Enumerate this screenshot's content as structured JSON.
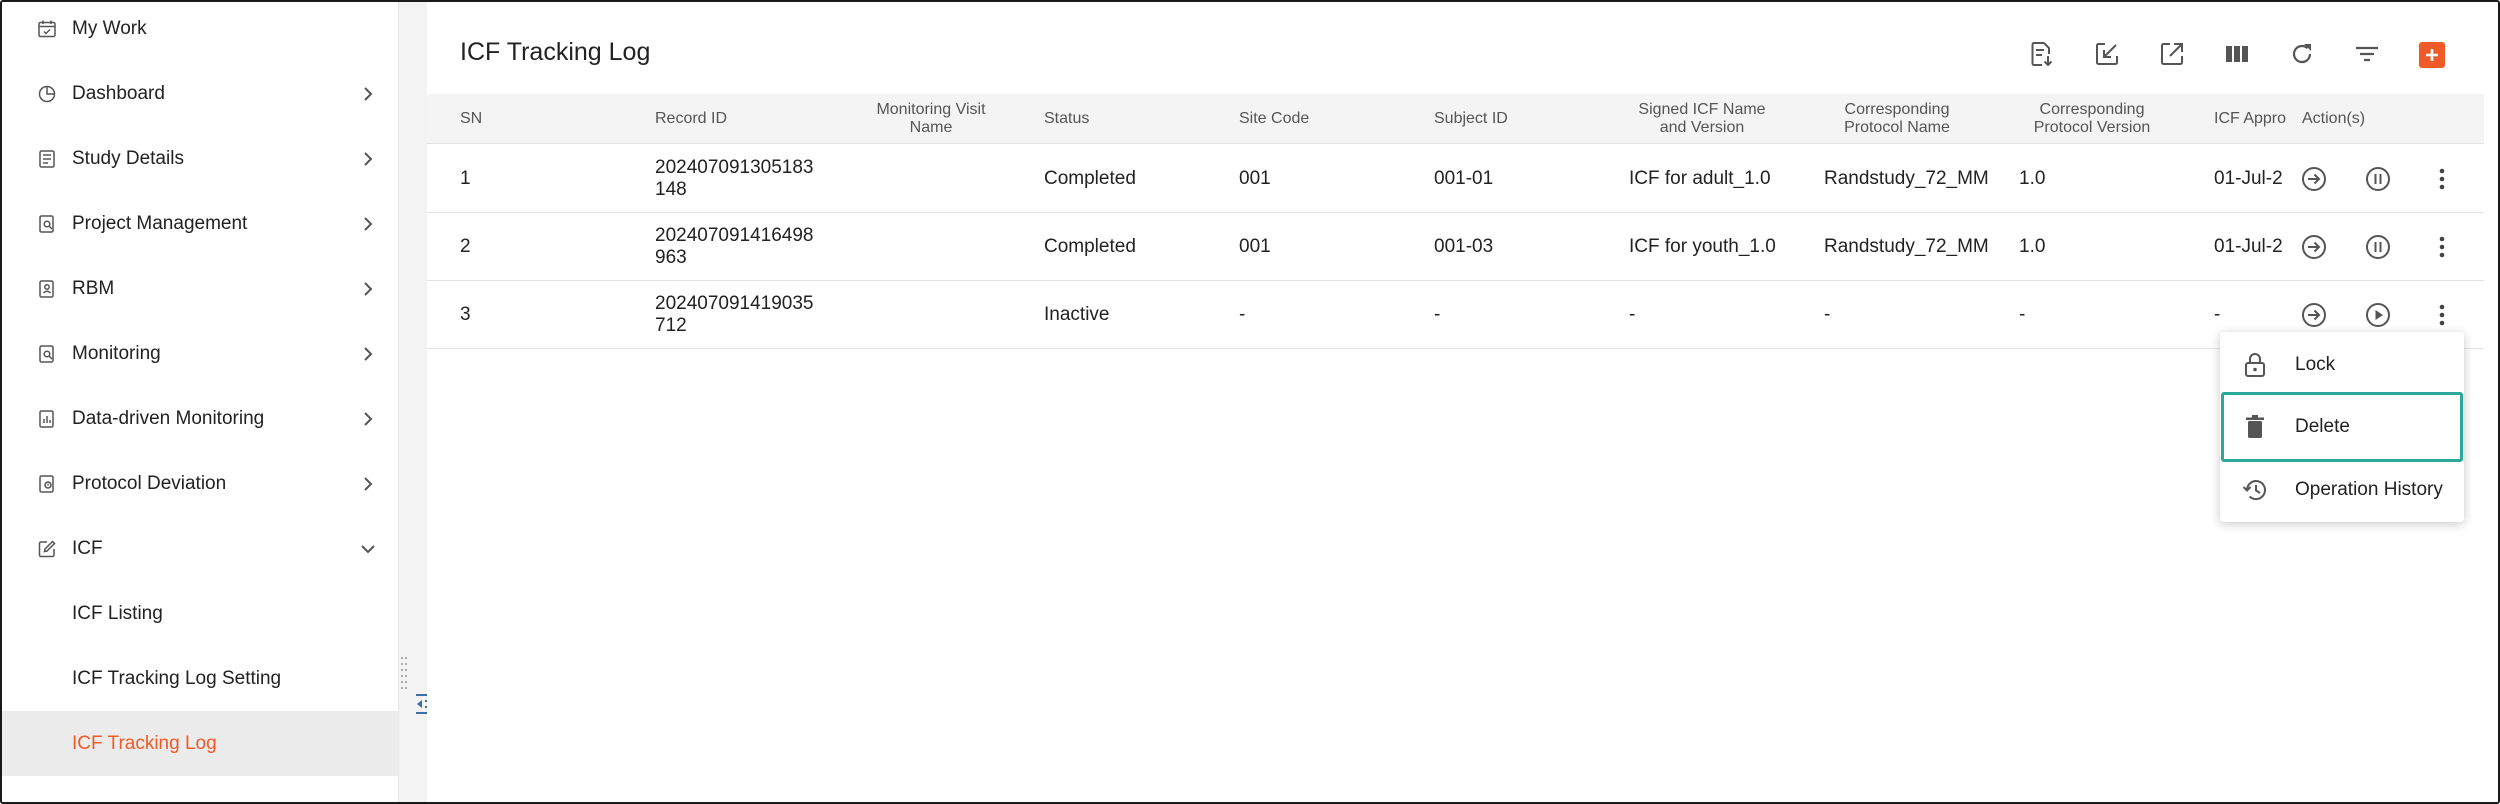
{
  "sidebar": {
    "items": [
      {
        "label": "My Work"
      },
      {
        "label": "Dashboard"
      },
      {
        "label": "Study Details"
      },
      {
        "label": "Project Management"
      },
      {
        "label": "RBM"
      },
      {
        "label": "Monitoring"
      },
      {
        "label": "Data-driven Monitoring"
      },
      {
        "label": "Protocol Deviation"
      },
      {
        "label": "ICF"
      }
    ],
    "sub_items": [
      {
        "label": "ICF Listing"
      },
      {
        "label": "ICF Tracking Log Setting"
      },
      {
        "label": "ICF Tracking Log"
      }
    ]
  },
  "page": {
    "title": "ICF Tracking Log"
  },
  "toolbar": {
    "icons": [
      "export-icon",
      "import-icon",
      "open-external-icon",
      "columns-icon",
      "refresh-icon",
      "filter-icon",
      "add-icon"
    ]
  },
  "table": {
    "headers": {
      "sn": "SN",
      "record_id": "Record ID",
      "monitoring_visit_name": "Monitoring Visit\nName",
      "status": "Status",
      "site_code": "Site Code",
      "subject_id": "Subject ID",
      "signed_icf": "Signed ICF Name\nand Version",
      "protocol_name": "Corresponding\nProtocol Name",
      "protocol_version": "Corresponding\nProtocol Version",
      "icf_approval": "ICF Appro",
      "actions": "Action(s)"
    },
    "rows": [
      {
        "sn": "1",
        "record_id": "202407091305183\n148",
        "monitoring_visit_name": "",
        "status": "Completed",
        "site_code": "001",
        "subject_id": "001-01",
        "signed_icf": "ICF for adult_1.0",
        "protocol_name": "Randstudy_72_MM",
        "protocol_version": "1.0",
        "icf_approval": "01-Jul-2",
        "state_action": "pause"
      },
      {
        "sn": "2",
        "record_id": "202407091416498\n963",
        "monitoring_visit_name": "",
        "status": "Completed",
        "site_code": "001",
        "subject_id": "001-03",
        "signed_icf": "ICF for youth_1.0",
        "protocol_name": "Randstudy_72_MM",
        "protocol_version": "1.0",
        "icf_approval": "01-Jul-2",
        "state_action": "pause"
      },
      {
        "sn": "3",
        "record_id": "202407091419035\n712",
        "monitoring_visit_name": "",
        "status": "Inactive",
        "site_code": "-",
        "subject_id": "-",
        "signed_icf": "-",
        "protocol_name": "-",
        "protocol_version": "-",
        "icf_approval": "-",
        "state_action": "play"
      }
    ]
  },
  "context_menu": {
    "items": [
      {
        "label": "Lock",
        "icon": "lock-icon"
      },
      {
        "label": "Delete",
        "icon": "trash-icon"
      },
      {
        "label": "Operation History",
        "icon": "history-icon"
      }
    ],
    "highlighted": "Delete"
  },
  "colors": {
    "accent": "#f05a28",
    "highlight": "#2aa89a",
    "icon": "#555555"
  }
}
